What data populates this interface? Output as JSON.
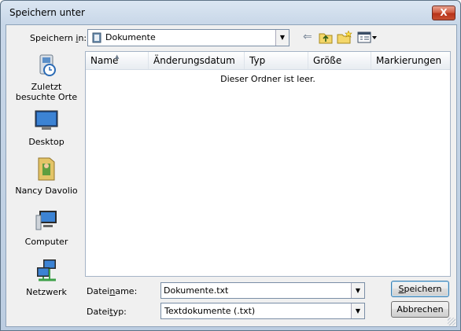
{
  "window": {
    "title": "Speichern unter",
    "close_label": "X"
  },
  "toolbar": {
    "lookin_label_pre": "Speichern ",
    "lookin_label_ul": "i",
    "lookin_label_post": "n:",
    "lookin_value": "Dokumente",
    "back_icon": "back-arrow-icon",
    "up_icon": "up-folder-icon",
    "newfolder_icon": "new-folder-icon",
    "views_icon": "views-menu-icon"
  },
  "places": [
    {
      "label": "Zuletzt besuchte Orte",
      "icon": "recent-places-icon"
    },
    {
      "label": "Desktop",
      "icon": "desktop-icon"
    },
    {
      "label": "Nancy Davolio",
      "icon": "user-folder-icon"
    },
    {
      "label": "Computer",
      "icon": "computer-icon"
    },
    {
      "label": "Netzwerk",
      "icon": "network-icon"
    }
  ],
  "filelist": {
    "columns": [
      "Name",
      "Änderungsdatum",
      "Typ",
      "Größe",
      "Markierungen"
    ],
    "empty_message": "Dieser Ordner ist leer."
  },
  "form": {
    "filename_label_pre": "Datei",
    "filename_label_ul": "n",
    "filename_label_post": "ame:",
    "filename_value": "Dokumente.txt",
    "filetype_label_pre": "Datei",
    "filetype_label_ul": "t",
    "filetype_label_post": "yp:",
    "filetype_value": "Textdokumente (.txt)"
  },
  "buttons": {
    "save_ul": "S",
    "save_rest": "peichern",
    "cancel_label": "Abbrechen"
  }
}
